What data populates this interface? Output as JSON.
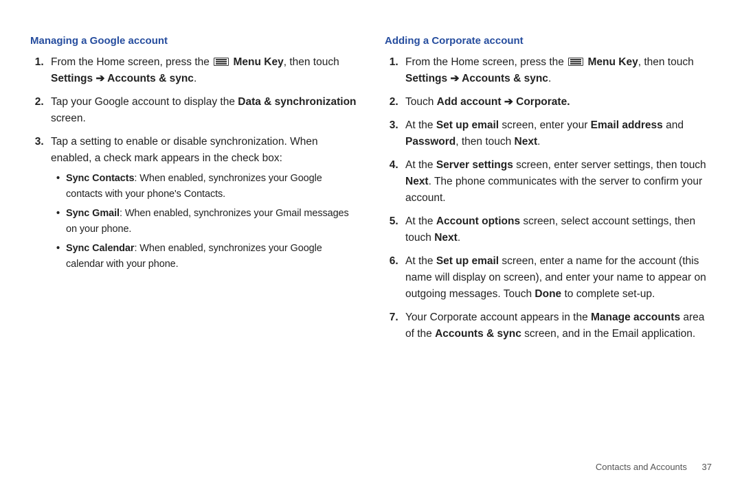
{
  "left": {
    "heading": "Managing a Google account",
    "step1_pre": "From the Home screen, press the ",
    "step1_menu": "Menu Key",
    "step1_mid": ", then touch ",
    "step1_path": "Settings ➔ Accounts & sync",
    "step1_end": ".",
    "step2_a": "Tap your Google account to display the ",
    "step2_b": "Data & synchronization",
    "step2_c": " screen.",
    "step3": "Tap a setting to enable or disable synchronization. When enabled, a check mark appears in the check box:",
    "b1_t": "Sync Contacts",
    "b1_d": ": When enabled, synchronizes your Google contacts with your phone's Contacts.",
    "b2_t": "Sync Gmail",
    "b2_d": ": When enabled, synchronizes your Gmail messages on your phone.",
    "b3_t": "Sync Calendar",
    "b3_d": ": When enabled, synchronizes your Google calendar with your phone."
  },
  "right": {
    "heading": "Adding a Corporate account",
    "s1_pre": "From the Home screen, press the ",
    "s1_menu": "Menu Key",
    "s1_mid": ", then touch ",
    "s1_path": "Settings ➔ Accounts & sync",
    "s1_end": ".",
    "s2_a": "Touch ",
    "s2_b": "Add account ➔ Corporate.",
    "s3_a": "At the ",
    "s3_b": "Set up email",
    "s3_c": " screen, enter your ",
    "s3_d": "Email address",
    "s3_e": " and ",
    "s3_f": "Password",
    "s3_g": ", then touch ",
    "s3_h": "Next",
    "s3_i": ".",
    "s4_a": "At the ",
    "s4_b": "Server settings",
    "s4_c": " screen, enter server settings, then touch ",
    "s4_d": "Next",
    "s4_e": ". The phone communicates with the server to confirm your account.",
    "s5_a": "At the ",
    "s5_b": "Account options",
    "s5_c": " screen, select account settings, then touch ",
    "s5_d": "Next",
    "s5_e": ".",
    "s6_a": "At the ",
    "s6_b": "Set up email",
    "s6_c": " screen, enter a name for the account (this name will display on screen), and enter your name to appear on outgoing messages. Touch ",
    "s6_d": "Done",
    "s6_e": " to complete set-up.",
    "s7_a": "Your Corporate account appears in the ",
    "s7_b": "Manage accounts",
    "s7_c": " area of the ",
    "s7_d": "Accounts & sync",
    "s7_e": " screen, and in the Email application."
  },
  "footer": {
    "section": "Contacts and Accounts",
    "page": "37"
  }
}
